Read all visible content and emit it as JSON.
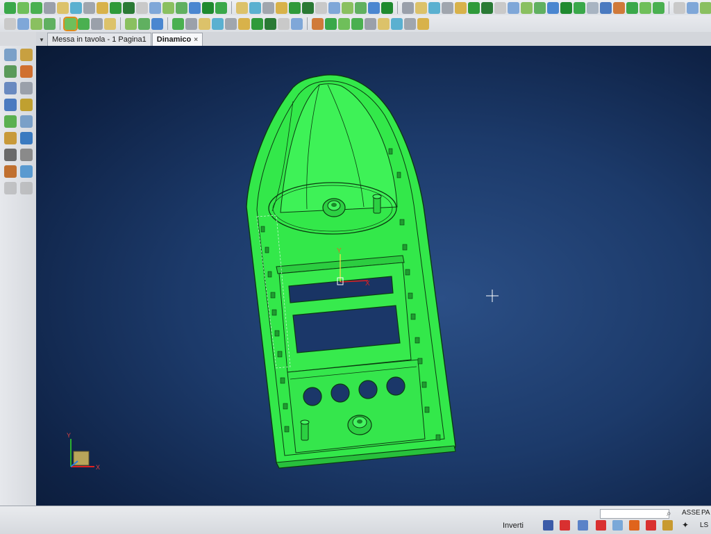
{
  "tabs": [
    {
      "label": "Messa in tavola - 1 Pagina1",
      "active": false
    },
    {
      "label": "Dinamico",
      "active": true
    }
  ],
  "tab_close_glyph": "×",
  "tab_menu_glyph": "▼",
  "viewport": {
    "background": "#1c3a6a",
    "model_color": "#33e84a",
    "cursor": "crosshair",
    "triad_labels": {
      "x": "X",
      "y": "Y"
    },
    "origin_labels": {
      "x": "X",
      "y": "Y"
    }
  },
  "statusbar": {
    "search_placeholder": "",
    "asse_label": "ASSE",
    "par_label": "PA",
    "inverti_label": "Inverti",
    "ls_label": "LS"
  },
  "icons": {
    "search": "search-icon",
    "close": "close-icon",
    "menu": "chevron-down-icon"
  },
  "colors": {
    "accent_selection": "#e08a1a",
    "toolbar_bg": "#e4e6ea"
  }
}
